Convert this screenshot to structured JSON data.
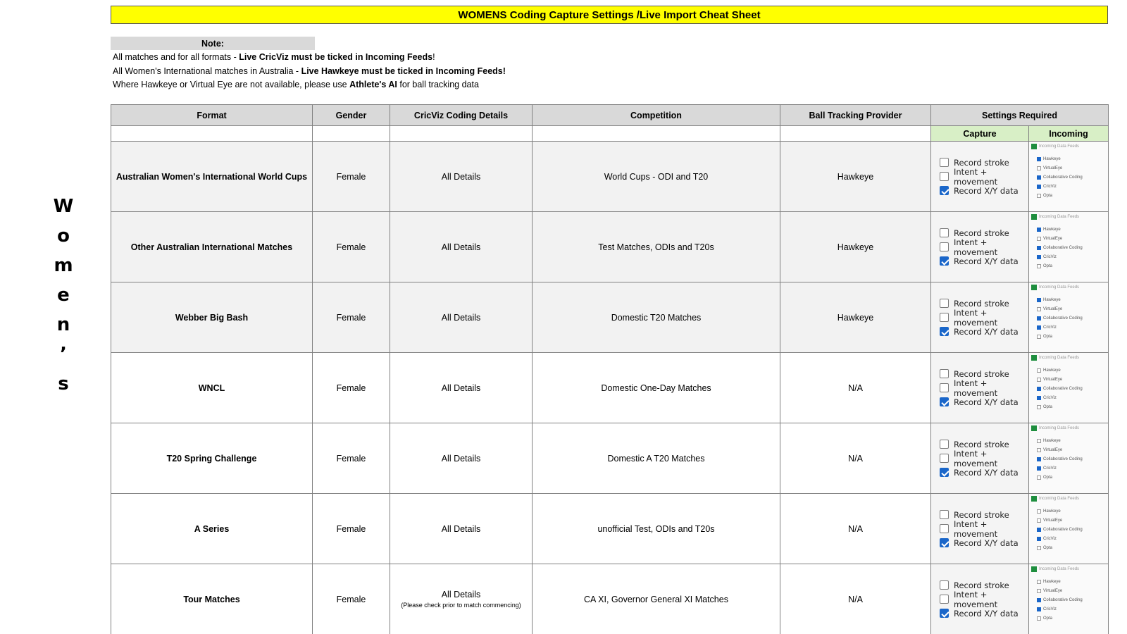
{
  "vertical_label": [
    "W",
    "o",
    "m",
    "e",
    "n",
    "’",
    "s"
  ],
  "title": "WOMENS Coding Capture Settings /Live Import Cheat Sheet",
  "note": {
    "heading": "Note:",
    "line1_pre": "All matches and for all formats - ",
    "line1_bold": "Live CricViz must be ticked in Incoming Feeds",
    "line1_post": "!",
    "line2_pre": "All Women's International matches in Australia - ",
    "line2_bold": "Live Hawkeye must be ticked in Incoming Feeds!",
    "line3_pre": "Where Hawkeye or Virtual Eye are not available, please use ",
    "line3_bold": "Athlete's AI",
    "line3_post": " for ball tracking data"
  },
  "headers": {
    "format": "Format",
    "gender": "Gender",
    "coding": "CricViz Coding Details",
    "competition": "Competition",
    "provider": "Ball Tracking Provider",
    "settings": "Settings Required",
    "capture": "Capture",
    "incoming": "Incoming"
  },
  "capture_options": [
    "Record stroke",
    "Intent + movement",
    "Record X/Y data"
  ],
  "incoming_panel": {
    "title": "Incoming Data Feeds",
    "options": [
      "Hawkeye",
      "VirtualEye",
      "Collaborative Coding",
      "CricViz",
      "Opta"
    ]
  },
  "rows": [
    {
      "format": "Australian Women's International World Cups",
      "gender": "Female",
      "coding": "All Details",
      "coding_note": "",
      "competition": "World Cups - ODI and T20",
      "provider": "Hawkeye"
    },
    {
      "format": "Other Australian International Matches",
      "gender": "Female",
      "coding": "All Details",
      "coding_note": "",
      "competition": "Test Matches, ODIs and T20s",
      "provider": "Hawkeye"
    },
    {
      "format": "Webber Big Bash",
      "gender": "Female",
      "coding": "All Details",
      "coding_note": "",
      "competition": "Domestic T20 Matches",
      "provider": "Hawkeye"
    },
    {
      "format": "WNCL",
      "gender": "Female",
      "coding": "All Details",
      "coding_note": "",
      "competition": "Domestic One-Day Matches",
      "provider": "N/A"
    },
    {
      "format": "T20 Spring Challenge",
      "gender": "Female",
      "coding": "All Details",
      "coding_note": "",
      "competition": "Domestic A T20 Matches",
      "provider": "N/A"
    },
    {
      "format": "A Series",
      "gender": "Female",
      "coding": "All Details",
      "coding_note": "",
      "competition": "unofficial Test, ODIs and T20s",
      "provider": "N/A"
    },
    {
      "format": "Tour Matches",
      "gender": "Female",
      "coding": "All Details",
      "coding_note": "(Please check prior to match commencing)",
      "competition": "CA XI, Governor General XI Matches",
      "provider": "N/A"
    }
  ]
}
